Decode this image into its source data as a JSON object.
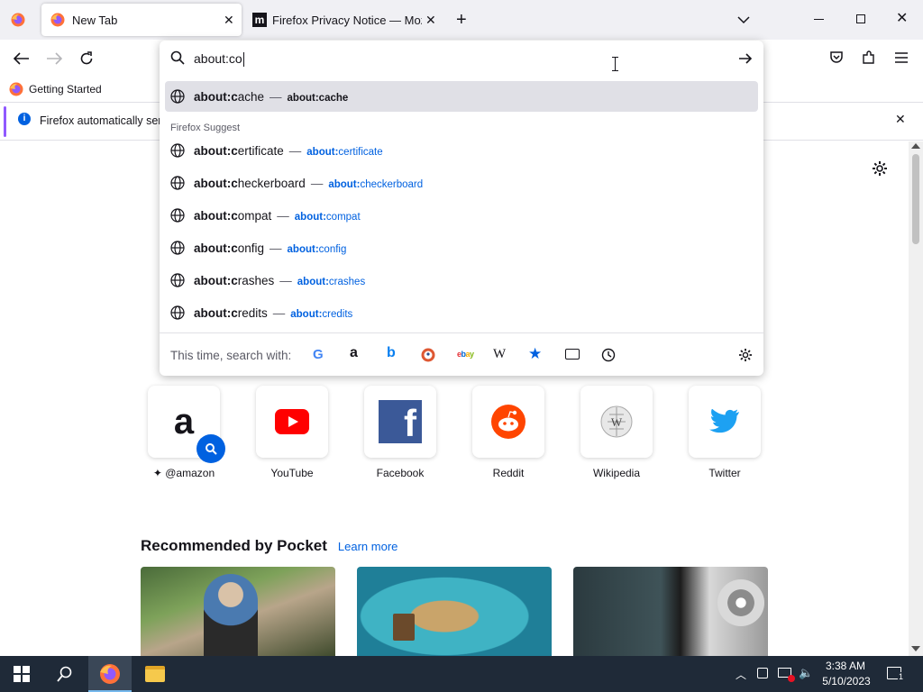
{
  "window": {
    "title": "New Tab"
  },
  "tabs": [
    {
      "label": "New Tab",
      "icon": "firefox-icon",
      "active": true
    },
    {
      "label": "Firefox Privacy Notice — Mozill",
      "icon": "mozilla-icon",
      "active": false
    }
  ],
  "urlbar": {
    "value": "about:co"
  },
  "bookmarks": [
    {
      "label": "Getting Started",
      "icon": "firefox-icon"
    }
  ],
  "notification": {
    "text": "Firefox automatically sen"
  },
  "suggestions": {
    "first": {
      "typed": "about:c",
      "rest": "ache",
      "url_typed": "about:",
      "url_rest": "cache"
    },
    "section_label": "Firefox Suggest",
    "items": [
      {
        "typed": "about:c",
        "rest": "ertificate",
        "url_typed": "about:",
        "url_rest": "certificate"
      },
      {
        "typed": "about:c",
        "rest": "heckerboard",
        "url_typed": "about:",
        "url_rest": "checkerboard"
      },
      {
        "typed": "about:c",
        "rest": "ompat",
        "url_typed": "about:",
        "url_rest": "compat"
      },
      {
        "typed": "about:c",
        "rest": "onfig",
        "url_typed": "about:",
        "url_rest": "config"
      },
      {
        "typed": "about:c",
        "rest": "rashes",
        "url_typed": "about:",
        "url_rest": "crashes"
      },
      {
        "typed": "about:c",
        "rest": "redits",
        "url_typed": "about:",
        "url_rest": "credits"
      }
    ],
    "separator": "—",
    "search_with_label": "This time, search with:",
    "engines": [
      "google-icon",
      "amazon-icon",
      "bing-icon",
      "duckduckgo-icon",
      "ebay-icon",
      "wikipedia-icon",
      "bookmarks-star-icon",
      "tabs-icon",
      "history-icon"
    ]
  },
  "top_sites": [
    {
      "label": "@amazon",
      "icon": "amazon-icon"
    },
    {
      "label": "YouTube",
      "icon": "youtube-icon"
    },
    {
      "label": "Facebook",
      "icon": "facebook-icon"
    },
    {
      "label": "Reddit",
      "icon": "reddit-icon"
    },
    {
      "label": "Wikipedia",
      "icon": "wikipedia-icon"
    },
    {
      "label": "Twitter",
      "icon": "twitter-icon"
    }
  ],
  "pocket": {
    "heading": "Recommended by Pocket",
    "learn_more": "Learn more"
  },
  "taskbar": {
    "time": "3:38 AM",
    "date": "5/10/2023",
    "notification_count": "1"
  },
  "colors": {
    "accent": "#0061e0",
    "taskbar": "#1f2a38",
    "tab_strip": "#f0f0f4"
  }
}
